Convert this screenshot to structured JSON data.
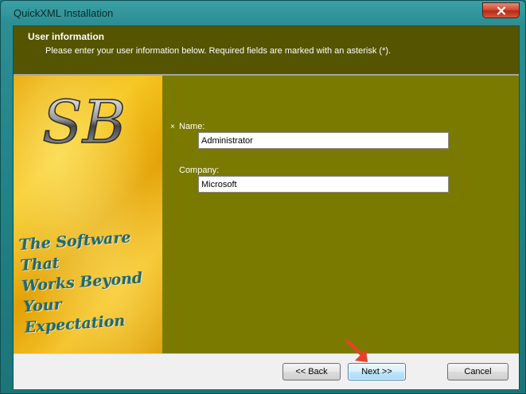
{
  "window": {
    "title": "QuickXML Installation"
  },
  "header": {
    "title": "User information",
    "description": "Please enter your user information below. Required fields are marked with an asterisk (*)."
  },
  "banner": {
    "logo_text": "SB",
    "slogan_lines": [
      "The Software That",
      "Works Beyond",
      "Your Expectation"
    ]
  },
  "form": {
    "required_marker": "×",
    "name_label": "Name:",
    "name_value": "Administrator",
    "company_label": "Company:",
    "company_value": "Microsoft"
  },
  "footer": {
    "back_label": "<< Back",
    "next_label": "Next >>",
    "cancel_label": "Cancel"
  },
  "colors": {
    "header_bg": "#555400",
    "body_bg": "#7a7a00",
    "annotation_arrow": "#e8402c"
  },
  "icons": {
    "close": "close-icon",
    "annotation": "red-arrow-icon"
  }
}
